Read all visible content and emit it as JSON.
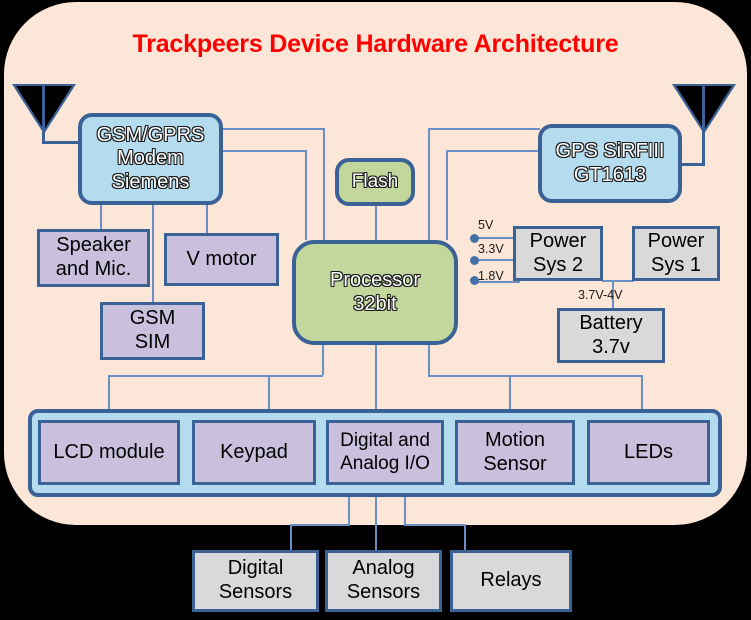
{
  "diagram": {
    "title": "Trackpeers Device Hardware Architecture",
    "colors": {
      "background": "#000000",
      "panel": "#fbe6d7",
      "title": "#ff0000",
      "border": "#3a6296",
      "wire": "#6b8ec4",
      "blue_block": "#b5dcee",
      "green_block": "#c3d69b",
      "purple_block": "#c9c0dd",
      "gray_block": "#d9d9d9"
    },
    "antennas": [
      {
        "name": "gsm-antenna"
      },
      {
        "name": "gps-antenna"
      }
    ],
    "blocks": {
      "gsm_modem": {
        "line1": "GSM/GPRS",
        "line2": "Modem",
        "line3": "Siemens"
      },
      "gps": {
        "line1": "GPS SiRFIII",
        "line2": "GT1613"
      },
      "flash": {
        "line1": "Flash"
      },
      "processor": {
        "line1": "Processor",
        "line2": "32bit"
      },
      "speaker": {
        "line1": "Speaker",
        "line2": "and Mic."
      },
      "v_motor": {
        "line1": "V motor"
      },
      "gsm_sim": {
        "line1": "GSM",
        "line2": "SIM"
      },
      "power_sys_2": {
        "line1": "Power",
        "line2": "Sys 2"
      },
      "power_sys_1": {
        "line1": "Power",
        "line2": "Sys 1"
      },
      "battery": {
        "line1": "Battery",
        "line2": "3.7v"
      }
    },
    "voltage_rails": [
      {
        "label": "5V"
      },
      {
        "label": "3.3V"
      },
      {
        "label": "1.8V"
      }
    ],
    "battery_rail": {
      "label": "3.7V-4V"
    },
    "io_blocks": [
      {
        "line1": "LCD module",
        "line2": ""
      },
      {
        "line1": "Keypad",
        "line2": ""
      },
      {
        "line1": "Digital and",
        "line2": "Analog I/O"
      },
      {
        "line1": "Motion",
        "line2": "Sensor"
      },
      {
        "line1": "LEDs",
        "line2": ""
      }
    ],
    "external_blocks": [
      {
        "line1": "Digital",
        "line2": "Sensors"
      },
      {
        "line1": "Analog",
        "line2": "Sensors"
      },
      {
        "line1": "Relays",
        "line2": ""
      }
    ]
  }
}
